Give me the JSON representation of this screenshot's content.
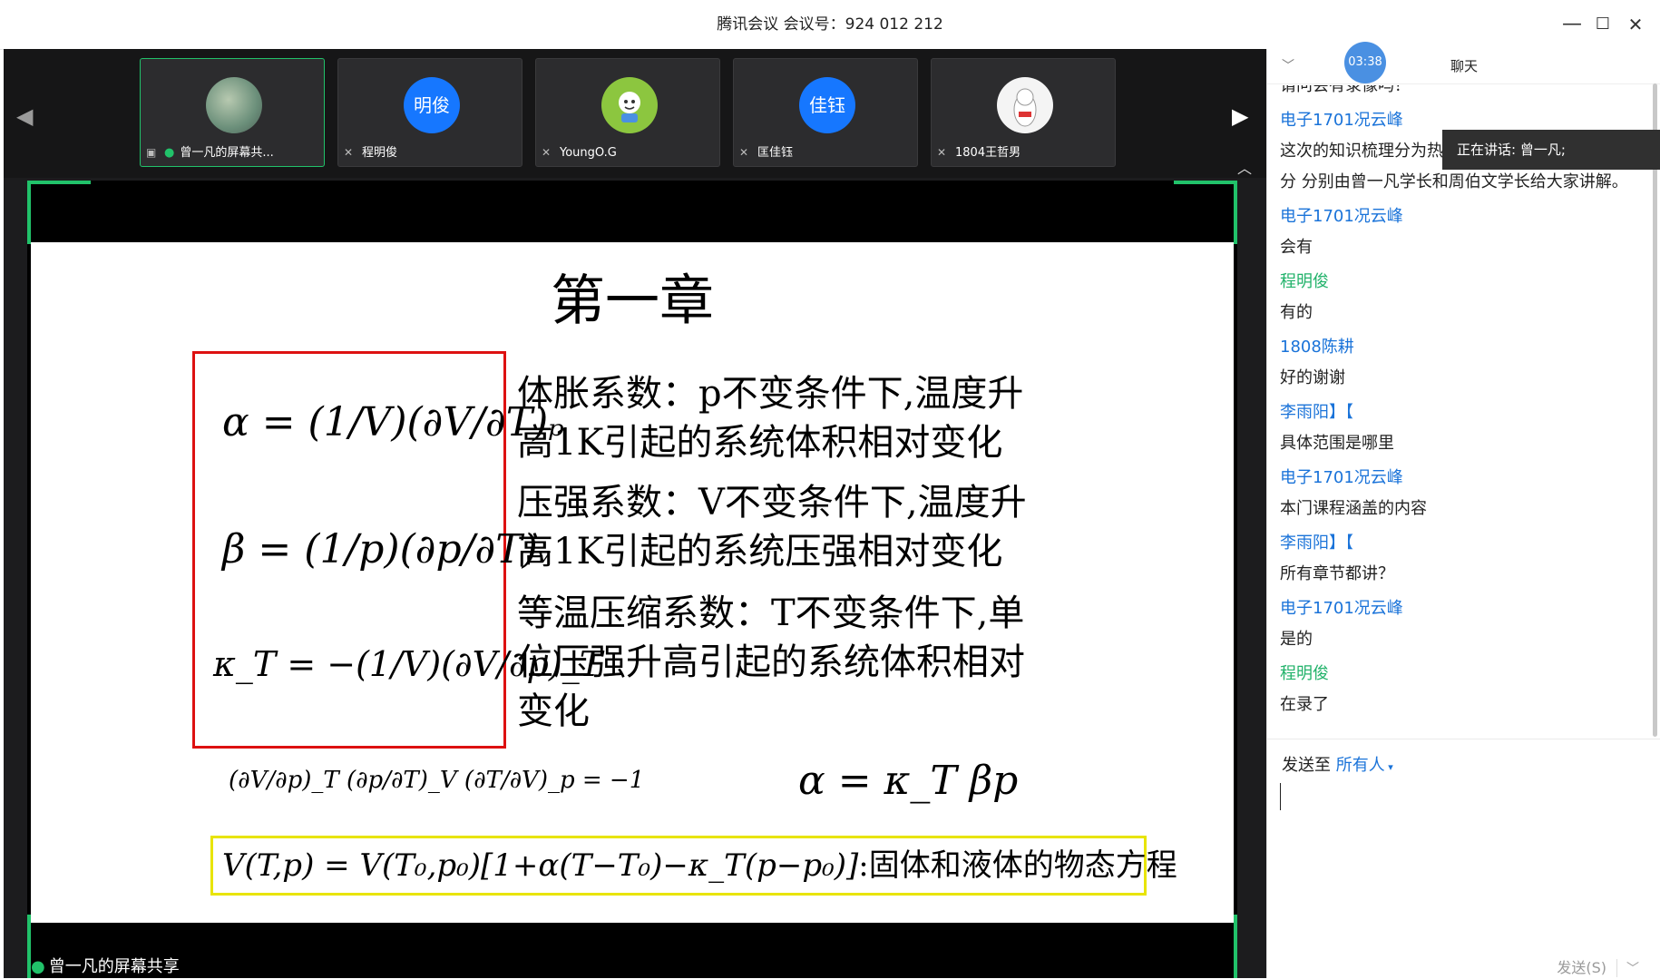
{
  "window": {
    "title": "腾讯会议 会议号：924 012 212",
    "minimize": "—",
    "maximize": "☐",
    "close": "✕"
  },
  "timer": "03:38",
  "participants": [
    {
      "name": "曾一凡的屏幕共...",
      "avatar_text": "",
      "avatar_color": "#6b8f7a",
      "active": true
    },
    {
      "name": "程明俊",
      "avatar_text": "明俊",
      "avatar_color": "#1677ff",
      "active": false
    },
    {
      "name": "YoungO.G",
      "avatar_text": "",
      "avatar_color": "#8cc63f",
      "active": false
    },
    {
      "name": "匡佳钰",
      "avatar_text": "佳钰",
      "avatar_color": "#1677ff",
      "active": false
    },
    {
      "name": "1804王哲男",
      "avatar_text": "",
      "avatar_color": "#f0f0f0",
      "active": false
    }
  ],
  "slide": {
    "heading": "第一章",
    "formula_alpha": "α = (1/V)(∂V/∂T)ₚ",
    "formula_beta": "β = (1/p)(∂p/∂T)ᵥ",
    "formula_kappa": "κ_T = −(1/V)(∂V/∂p)_T",
    "desc_alpha": "体胀系数：p不变条件下,温度升高1K引起的系统体积相对变化",
    "desc_beta": "压强系数：V不变条件下,温度升高1K引起的系统压强相对变化",
    "desc_kappa": "等温压缩系数：T不变条件下,单位压强升高引起的系统体积相对变化",
    "identity": "(∂V/∂p)_T (∂p/∂T)_V (∂T/∂V)_p = −1",
    "relation": "α = κ_T βp",
    "eos_formula": "V(T,p) = V(T₀,p₀)[1+α(T−T₀)−κ_T(p−p₀)]",
    "eos_text": ":固体和液体的物态方程"
  },
  "sharer_label": "曾一凡的屏幕共享",
  "chat": {
    "title": "聊天",
    "truncated_top": "请问会有录像吗？",
    "messages": [
      {
        "sender": "电子1701况云峰",
        "color": "#1a73d9",
        "text": "这次的知识梳理分为热学和统计物理两部"
      },
      {
        "sender": "",
        "color": "#1a73d9",
        "text": "分 分别由曾一凡学长和周伯文学长给大家讲解。"
      },
      {
        "sender": "电子1701况云峰",
        "color": "#1a73d9",
        "text": "会有"
      },
      {
        "sender": "程明俊",
        "color": "#21b26a",
        "text": "有的"
      },
      {
        "sender": "1808陈耕",
        "color": "#1a73d9",
        "text": "好的谢谢"
      },
      {
        "sender": "李雨阳】【",
        "color": "#1a73d9",
        "text": "具体范围是哪里"
      },
      {
        "sender": "电子1701况云峰",
        "color": "#1a73d9",
        "text": "本门课程涵盖的内容"
      },
      {
        "sender": "李雨阳】【",
        "color": "#1a73d9",
        "text": "所有章节都讲？"
      },
      {
        "sender": "电子1701况云峰",
        "color": "#1a73d9",
        "text": "是的"
      },
      {
        "sender": "程明俊",
        "color": "#21b26a",
        "text": "在录了"
      }
    ],
    "speaking": "正在讲话: 曾一凡;",
    "send_to_label": "发送至",
    "send_to_target": "所有人",
    "send_button": "发送(S)"
  }
}
